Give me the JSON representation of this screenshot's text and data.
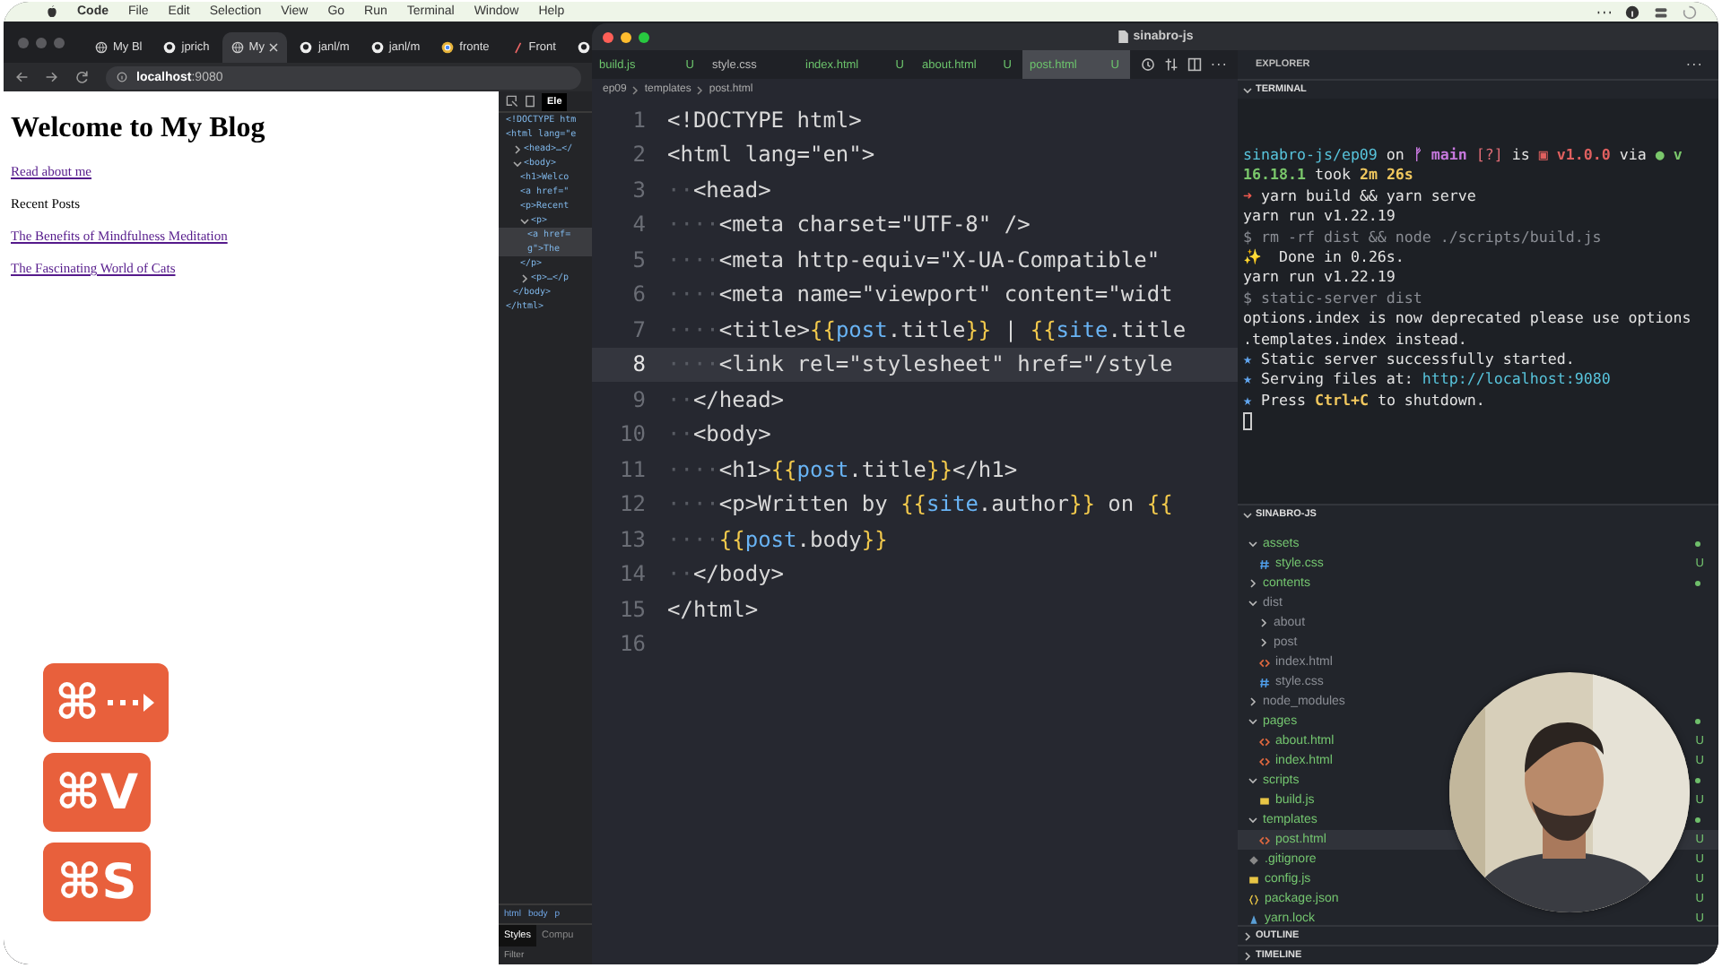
{
  "menubar": {
    "app": "Code",
    "items": [
      "File",
      "Edit",
      "Selection",
      "View",
      "Go",
      "Run",
      "Terminal",
      "Window",
      "Help"
    ]
  },
  "browser": {
    "tabs": [
      {
        "label": "My Bl",
        "kind": "globe",
        "selected": false
      },
      {
        "label": "jprich",
        "kind": "github",
        "selected": false
      },
      {
        "label": "My",
        "kind": "globe",
        "selected": true
      },
      {
        "label": "janl/m",
        "kind": "github",
        "selected": false
      },
      {
        "label": "janl/m",
        "kind": "github",
        "selected": false
      },
      {
        "label": "fronte",
        "kind": "chrome",
        "selected": false
      },
      {
        "label": "Front",
        "kind": "pen",
        "selected": false
      },
      {
        "kind": "github",
        "selected": false
      }
    ],
    "address": "**localhost**:9080",
    "page": {
      "heading": "Welcome to My Blog",
      "about_link": "Read about me",
      "section_label": "Recent Posts",
      "posts": [
        "The Benefits of Mindfulness Meditation",
        "The Fascinating World of Cats"
      ]
    },
    "devtools": {
      "tab": "Ele",
      "dom": [
        {
          "text": "<!DOCTYPE htm",
          "selected": false
        },
        {
          "text": "<html lang=\"e",
          "selected": false,
          "children": [
            {
              "text": "<head>…</",
              "selected": false,
              "expanded": false
            },
            {
              "text": "<body>",
              "selected": false,
              "expanded": true,
              "children": [
                {
                  "text": "<h1>Welco",
                  "selected": false
                },
                {
                  "text": "<a href=\"",
                  "selected": false
                },
                {
                  "text": "<p>Recent",
                  "selected": false
                },
                {
                  "text": "<p>",
                  "selected": false,
                  "expanded": true,
                  "children": [
                    {
                      "text": "<a href=",
                      "selected": true
                    },
                    {
                      "text": "g\">The ",
                      "selected": true
                    }
                  ],
                  "close": "</p>"
                },
                {
                  "text": "<p>…</p",
                  "selected": false,
                  "expanded": false
                }
              ],
              "close": "</body>"
            }
          ],
          "close": "</html>"
        }
      ],
      "crumbs": [
        "html",
        "body",
        "p"
      ],
      "panes": [
        {
          "label": "Styles",
          "selected": true
        },
        {
          "label": "Compu",
          "selected": false
        }
      ],
      "filter_placeholder": "Filter"
    }
  },
  "vscode": {
    "title": "sinabro-js",
    "tabs": [
      {
        "label": "build.js",
        "badge": "U",
        "untracked": true,
        "selected": false
      },
      {
        "label": "style.css",
        "untracked": false,
        "selected": false
      },
      {
        "label": "index.html",
        "badge": "U",
        "untracked": true,
        "selected": false
      },
      {
        "label": "about.html",
        "badge": "U",
        "untracked": true,
        "selected": false
      },
      {
        "label": "post.html",
        "badge": "U",
        "untracked": true,
        "selected": true
      }
    ],
    "breadcrumb": [
      "ep09",
      "templates",
      "post.html"
    ],
    "lines": [
      {
        "number": "1",
        "current": false,
        "tokens": [
          {
            "kind": "code",
            "t": "<!DOCTYPE html>"
          }
        ]
      },
      {
        "number": "2",
        "current": false,
        "tokens": [
          {
            "kind": "code",
            "t": "<html lang=\"en\">"
          }
        ]
      },
      {
        "number": "3",
        "current": false,
        "tokens": [
          {
            "kind": "ws",
            "t": "··"
          },
          {
            "kind": "code",
            "t": "<head>"
          }
        ]
      },
      {
        "number": "4",
        "current": false,
        "tokens": [
          {
            "kind": "ws",
            "t": "····"
          },
          {
            "kind": "code",
            "t": "<meta charset=\"UTF-8\" />"
          }
        ]
      },
      {
        "number": "5",
        "current": false,
        "tokens": [
          {
            "kind": "ws",
            "t": "····"
          },
          {
            "kind": "code",
            "t": "<meta http-equiv=\"X-UA-Compatible\""
          }
        ]
      },
      {
        "number": "6",
        "current": false,
        "tokens": [
          {
            "kind": "ws",
            "t": "····"
          },
          {
            "kind": "code",
            "t": "<meta name=\"viewport\" content=\"widt"
          }
        ]
      },
      {
        "number": "7",
        "current": false,
        "tokens": [
          {
            "kind": "ws",
            "t": "····"
          },
          {
            "kind": "code",
            "t": "<title>"
          },
          {
            "kind": "brace",
            "t": "{{"
          },
          {
            "kind": "var",
            "t": "post"
          },
          {
            "kind": "code",
            "t": ".title"
          },
          {
            "kind": "brace",
            "t": "}}"
          },
          {
            "kind": "code",
            "t": " | "
          },
          {
            "kind": "brace",
            "t": "{{"
          },
          {
            "kind": "var",
            "t": "site"
          },
          {
            "kind": "code",
            "t": ".title"
          }
        ]
      },
      {
        "number": "8",
        "current": true,
        "tokens": [
          {
            "kind": "ws",
            "t": "····"
          },
          {
            "kind": "code",
            "t": "<link rel=\"stylesheet\" href=\"/style"
          }
        ]
      },
      {
        "number": "9",
        "current": false,
        "tokens": [
          {
            "kind": "ws",
            "t": "··"
          },
          {
            "kind": "code",
            "t": "</head>"
          }
        ]
      },
      {
        "number": "10",
        "current": false,
        "tokens": [
          {
            "kind": "ws",
            "t": "··"
          },
          {
            "kind": "code",
            "t": "<body>"
          }
        ]
      },
      {
        "number": "11",
        "current": false,
        "tokens": [
          {
            "kind": "ws",
            "t": "····"
          },
          {
            "kind": "code",
            "t": "<h1>"
          },
          {
            "kind": "brace",
            "t": "{{"
          },
          {
            "kind": "var",
            "t": "post"
          },
          {
            "kind": "code",
            "t": ".title"
          },
          {
            "kind": "brace",
            "t": "}}"
          },
          {
            "kind": "code",
            "t": "</h1>"
          }
        ]
      },
      {
        "number": "12",
        "current": false,
        "tokens": [
          {
            "kind": "ws",
            "t": "····"
          },
          {
            "kind": "code",
            "t": "<p>Written by "
          },
          {
            "kind": "brace",
            "t": "{{"
          },
          {
            "kind": "var",
            "t": "site"
          },
          {
            "kind": "code",
            "t": ".author"
          },
          {
            "kind": "brace",
            "t": "}}"
          },
          {
            "kind": "code",
            "t": " on "
          },
          {
            "kind": "brace",
            "t": "{{"
          }
        ]
      },
      {
        "number": "13",
        "current": false,
        "tokens": [
          {
            "kind": "ws",
            "t": "····"
          },
          {
            "kind": "brace",
            "t": "{{"
          },
          {
            "kind": "var",
            "t": "post"
          },
          {
            "kind": "code",
            "t": ".body"
          },
          {
            "kind": "brace",
            "t": "}}"
          }
        ]
      },
      {
        "number": "14",
        "current": false,
        "tokens": [
          {
            "kind": "ws",
            "t": "··"
          },
          {
            "kind": "code",
            "t": "</body>"
          }
        ]
      },
      {
        "number": "15",
        "current": false,
        "tokens": [
          {
            "kind": "code",
            "t": "</html>"
          }
        ]
      },
      {
        "number": "16",
        "current": false
      }
    ],
    "explorer_title": "EXPLORER",
    "terminal": {
      "title": "TERMINAL",
      "expanded": true,
      "lines": [
        [
          {
            "kind": "path",
            "t": "sinabro-js/ep09"
          },
          {
            "kind": "plain",
            "t": " on "
          },
          {
            "kind": "branch",
            "t": "ᚠ main"
          },
          {
            "kind": "warn",
            "t": " [?]"
          },
          {
            "kind": "plain",
            "t": " is "
          },
          {
            "kind": "version",
            "t": "▣ v1.0.0"
          },
          {
            "kind": "plain",
            "t": " via "
          },
          {
            "kind": "node",
            "t": "● v"
          }
        ],
        [
          {
            "kind": "node",
            "t": "16.18.1"
          },
          {
            "kind": "plain",
            "t": " took "
          },
          {
            "kind": "time",
            "t": "2m 26s"
          }
        ],
        [
          {
            "kind": "prompt",
            "t": "➜"
          },
          {
            "kind": "plain",
            "t": " yarn build && yarn serve"
          }
        ],
        [
          {
            "kind": "plain",
            "t": "yarn run v1.22.19"
          }
        ],
        [
          {
            "kind": "dim",
            "t": "$ rm -rf dist && node ./scripts/build.js"
          }
        ],
        [
          {
            "kind": "time",
            "t": "✨"
          },
          {
            "kind": "plain",
            "t": "  Done in 0.26s."
          }
        ],
        [
          {
            "kind": "plain",
            "t": "yarn run v1.22.19"
          }
        ],
        [
          {
            "kind": "dim",
            "t": "$ static-server dist"
          }
        ],
        [
          {
            "kind": "plain",
            "t": "options.index is now deprecated please use options"
          }
        ],
        [
          {
            "kind": "plain",
            "t": ".templates.index instead."
          }
        ],
        [
          {
            "kind": "star",
            "t": "★"
          },
          {
            "kind": "plain",
            "t": " Static server successfully started."
          }
        ],
        [
          {
            "kind": "star",
            "t": "★"
          },
          {
            "kind": "plain",
            "t": " Serving files at: "
          },
          {
            "kind": "path",
            "t": "http://localhost:9080"
          }
        ],
        [
          {
            "kind": "star",
            "t": "★"
          },
          {
            "kind": "plain",
            "t": " Press "
          },
          {
            "kind": "time",
            "t": "Ctrl+C"
          },
          {
            "kind": "plain",
            "t": " to shutdown."
          }
        ]
      ]
    },
    "project": {
      "title": "SINABRO-JS",
      "expanded": true,
      "tree": [
        {
          "name": "assets",
          "kind": "folder",
          "expanded": true,
          "dot": true,
          "ignored": false,
          "selected": false,
          "children": [
            {
              "name": "style.css",
              "kind": "css",
              "badge": "U",
              "ignored": false,
              "selected": false
            }
          ]
        },
        {
          "name": "contents",
          "kind": "folder",
          "expanded": false,
          "dot": true,
          "ignored": false,
          "selected": false
        },
        {
          "name": "dist",
          "kind": "folder",
          "expanded": true,
          "dot": false,
          "ignored": true,
          "selected": false,
          "children": [
            {
              "name": "about",
              "kind": "folder",
              "expanded": false,
              "dot": false,
              "ignored": true,
              "selected": false
            },
            {
              "name": "post",
              "kind": "folder",
              "expanded": false,
              "dot": false,
              "ignored": true,
              "selected": false
            },
            {
              "name": "index.html",
              "kind": "html",
              "ignored": true,
              "selected": false
            },
            {
              "name": "style.css",
              "kind": "css",
              "ignored": true,
              "selected": false
            }
          ]
        },
        {
          "name": "node_modules",
          "kind": "folder",
          "expanded": false,
          "dot": false,
          "ignored": true,
          "selected": false
        },
        {
          "name": "pages",
          "kind": "folder",
          "expanded": true,
          "dot": true,
          "ignored": false,
          "selected": false,
          "children": [
            {
              "name": "about.html",
              "kind": "html",
              "badge": "U",
              "ignored": false,
              "selected": false
            },
            {
              "name": "index.html",
              "kind": "html",
              "badge": "U",
              "ignored": false,
              "selected": false
            }
          ]
        },
        {
          "name": "scripts",
          "kind": "folder",
          "expanded": true,
          "dot": true,
          "ignored": false,
          "selected": false,
          "children": [
            {
              "name": "build.js",
              "kind": "js",
              "badge": "U",
              "ignored": false,
              "selected": false
            }
          ]
        },
        {
          "name": "templates",
          "kind": "folder",
          "expanded": true,
          "dot": true,
          "ignored": false,
          "selected": false,
          "children": [
            {
              "name": "post.html",
              "kind": "html",
              "badge": "U",
              "ignored": false,
              "selected": true
            }
          ]
        },
        {
          "name": ".gitignore",
          "kind": "git",
          "badge": "U",
          "ignored": false,
          "selected": false
        },
        {
          "name": "config.js",
          "kind": "js",
          "badge": "U",
          "ignored": false,
          "selected": false
        },
        {
          "name": "package.json",
          "kind": "json",
          "badge": "U",
          "ignored": false,
          "selected": false
        },
        {
          "name": "yarn.lock",
          "kind": "lock",
          "badge": "U",
          "ignored": false,
          "selected": false
        }
      ]
    },
    "sections": [
      {
        "title": "OUTLINE",
        "expanded": false
      },
      {
        "title": "TIMELINE",
        "expanded": false
      }
    ]
  },
  "shortcuts": [
    {
      "text": "⌘",
      "kind": "arrow"
    },
    {
      "text": "⌘V",
      "kind": "plain"
    },
    {
      "text": "⌘S",
      "kind": "plain"
    }
  ]
}
